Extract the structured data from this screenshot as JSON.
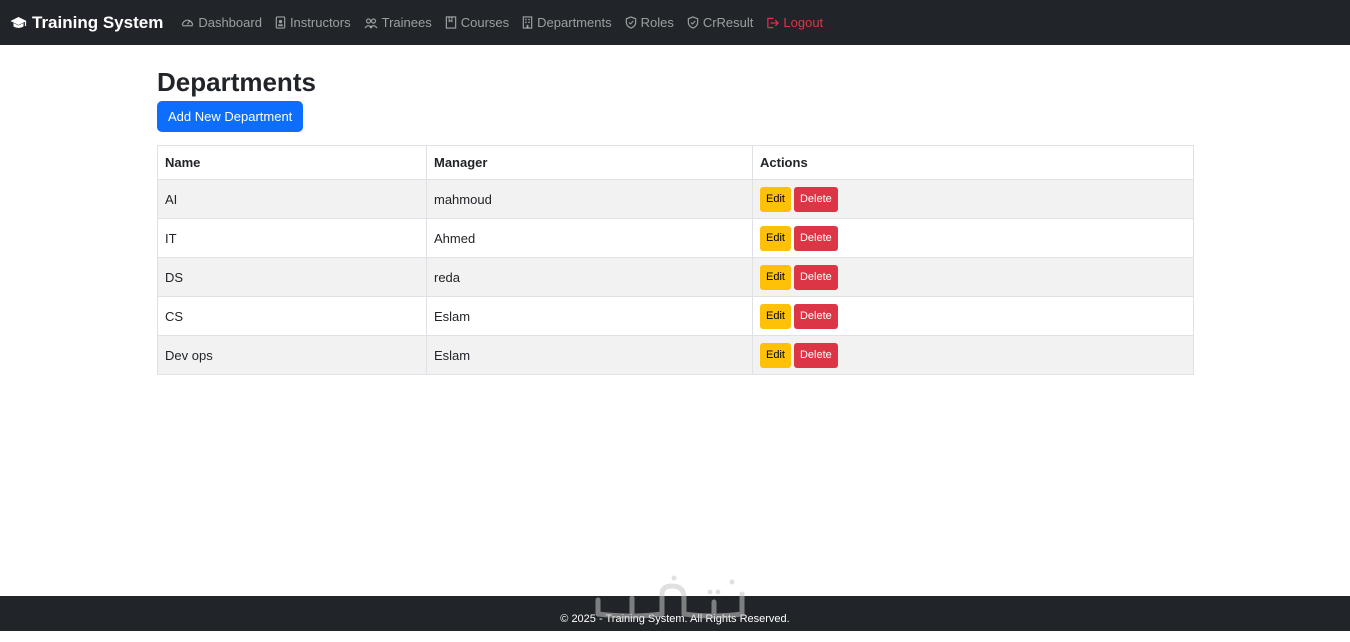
{
  "brand": {
    "name": "Training System",
    "icon": "graduation-cap-icon"
  },
  "nav": [
    {
      "label": "Dashboard",
      "icon": "speedometer-icon"
    },
    {
      "label": "Instructors",
      "icon": "person-badge-icon"
    },
    {
      "label": "Trainees",
      "icon": "people-icon"
    },
    {
      "label": "Courses",
      "icon": "book-icon"
    },
    {
      "label": "Departments",
      "icon": "building-icon"
    },
    {
      "label": "Roles",
      "icon": "shield-icon"
    },
    {
      "label": "CrResult",
      "icon": "shield-icon"
    },
    {
      "label": "Logout",
      "icon": "logout-icon"
    }
  ],
  "colors": {
    "navbar": "#212529",
    "primary": "#0d6efd",
    "warning": "#ffc107",
    "danger": "#dc3545"
  },
  "page": {
    "title": "Departments",
    "add_button": "Add New Department"
  },
  "table": {
    "headers": [
      "Name",
      "Manager",
      "Actions"
    ],
    "rows": [
      {
        "name": "AI",
        "manager": "mahmoud"
      },
      {
        "name": "IT",
        "manager": "Ahmed"
      },
      {
        "name": "DS",
        "manager": "reda"
      },
      {
        "name": "CS",
        "manager": "Eslam"
      },
      {
        "name": "Dev ops",
        "manager": "Eslam"
      }
    ],
    "edit_label": "Edit",
    "delete_label": "Delete"
  },
  "footer": {
    "text": "© 2025 - Training System. All Rights Reserved."
  }
}
